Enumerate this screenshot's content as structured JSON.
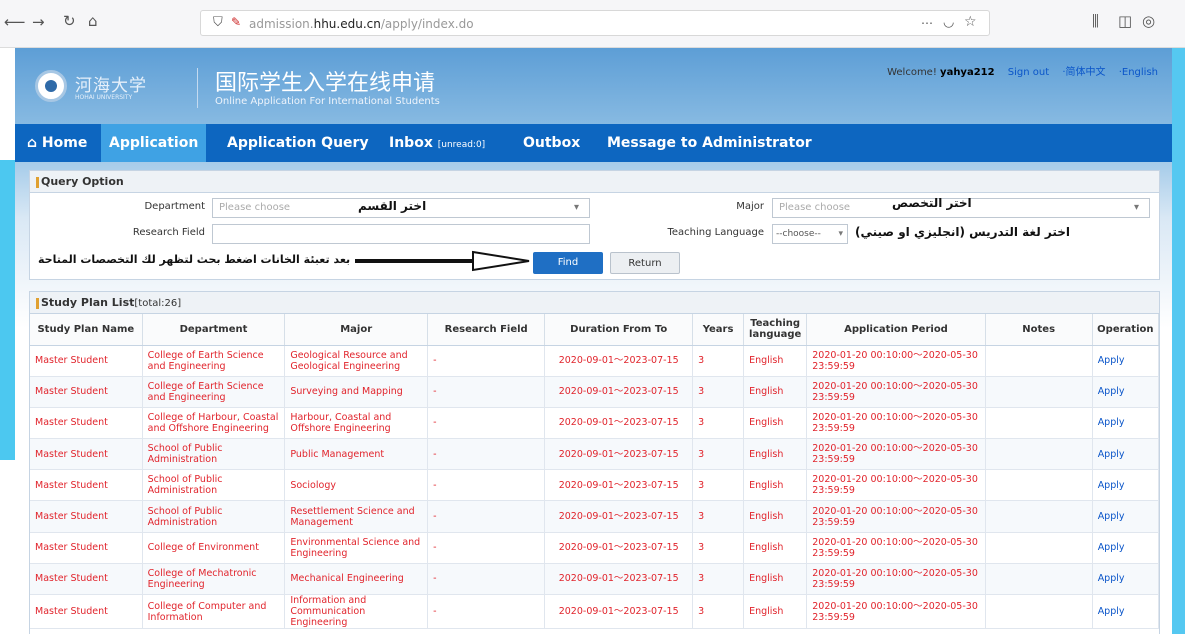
{
  "browser": {
    "url_prefix": "admission.",
    "url_domain": "hhu.edu.cn",
    "url_path": "/apply/index.do"
  },
  "header": {
    "logo_cn": "河海大学",
    "logo_en": "HOHAI UNIVERSITY",
    "portal_title_cn": "国际学生入学在线申请",
    "portal_title_en": "Online Application For International Students",
    "welcome_prefix": "Welcome!",
    "username": "yahya212",
    "sign_out": "Sign out",
    "lang_cn": "·简体中文",
    "lang_en": "·English"
  },
  "nav": {
    "home": "Home",
    "application": "Application",
    "query": "Application Query",
    "inbox": "Inbox",
    "inbox_unread": "[unread:0]",
    "outbox": "Outbox",
    "message_admin": "Message to Administrator"
  },
  "query": {
    "title": "Query Option",
    "department_label": "Department",
    "department_placeholder": "Please choose",
    "department_note": "اختر القسم",
    "major_label": "Major",
    "major_placeholder": "Please choose",
    "major_note": "اختر التخصص",
    "research_label": "Research Field",
    "teaching_label": "Teaching Language",
    "teaching_value": "--choose--",
    "teaching_note": "اختر لغة التدريس (انجليزي او صيني)",
    "find_button": "Find",
    "return_button": "Return",
    "find_note": "بعد تعبئة الخانات اضغط بحث لتظهر لك التخصصات المتاحة"
  },
  "study_plan": {
    "title": "Study Plan List",
    "total": "[total:26]",
    "columns": [
      "Study Plan Name",
      "Department",
      "Major",
      "Research Field",
      "Duration From To",
      "Years",
      "Teaching language",
      "Application Period",
      "Notes",
      "Operation"
    ],
    "rows": [
      {
        "name": "Master Student",
        "department": "College of Earth Science and Engineering",
        "major": "Geological Resource and Geological Engineering",
        "field": "-",
        "duration": "2020-09-01～2023-07-15",
        "years": "3",
        "language": "English",
        "period": "2020-01-20 00:10:00～2020-05-30 23:59:59",
        "notes": "",
        "op": "Apply"
      },
      {
        "name": "Master Student",
        "department": "College of Earth Science and Engineering",
        "major": "Surveying and Mapping",
        "field": "-",
        "duration": "2020-09-01～2023-07-15",
        "years": "3",
        "language": "English",
        "period": "2020-01-20 00:10:00～2020-05-30 23:59:59",
        "notes": "",
        "op": "Apply"
      },
      {
        "name": "Master Student",
        "department": "College of Harbour, Coastal and Offshore Engineering",
        "major": "Harbour, Coastal and Offshore Engineering",
        "field": "-",
        "duration": "2020-09-01～2023-07-15",
        "years": "3",
        "language": "English",
        "period": "2020-01-20 00:10:00～2020-05-30 23:59:59",
        "notes": "",
        "op": "Apply"
      },
      {
        "name": "Master Student",
        "department": "School of Public Administration",
        "major": "Public Management",
        "field": "-",
        "duration": "2020-09-01～2023-07-15",
        "years": "3",
        "language": "English",
        "period": "2020-01-20 00:10:00～2020-05-30 23:59:59",
        "notes": "",
        "op": "Apply"
      },
      {
        "name": "Master Student",
        "department": "School of Public Administration",
        "major": "Sociology",
        "field": "-",
        "duration": "2020-09-01～2023-07-15",
        "years": "3",
        "language": "English",
        "period": "2020-01-20 00:10:00～2020-05-30 23:59:59",
        "notes": "",
        "op": "Apply"
      },
      {
        "name": "Master Student",
        "department": "School of Public Administration",
        "major": "Resettlement Science and Management",
        "field": "-",
        "duration": "2020-09-01～2023-07-15",
        "years": "3",
        "language": "English",
        "period": "2020-01-20 00:10:00～2020-05-30 23:59:59",
        "notes": "",
        "op": "Apply"
      },
      {
        "name": "Master Student",
        "department": "College of Environment",
        "major": "Environmental Science and Engineering",
        "field": "-",
        "duration": "2020-09-01～2023-07-15",
        "years": "3",
        "language": "English",
        "period": "2020-01-20 00:10:00～2020-05-30 23:59:59",
        "notes": "",
        "op": "Apply"
      },
      {
        "name": "Master Student",
        "department": "College of Mechatronic Engineering",
        "major": "Mechanical Engineering",
        "field": "-",
        "duration": "2020-09-01～2023-07-15",
        "years": "3",
        "language": "English",
        "period": "2020-01-20 00:10:00～2020-05-30 23:59:59",
        "notes": "",
        "op": "Apply"
      },
      {
        "name": "Master Student",
        "department": "College of Computer and Information",
        "major": "Information and Communication Engineering",
        "field": "-",
        "duration": "2020-09-01～2023-07-15",
        "years": "3",
        "language": "English",
        "period": "2020-01-20 00:10:00～2020-05-30 23:59:59",
        "notes": "",
        "op": "Apply"
      }
    ]
  }
}
